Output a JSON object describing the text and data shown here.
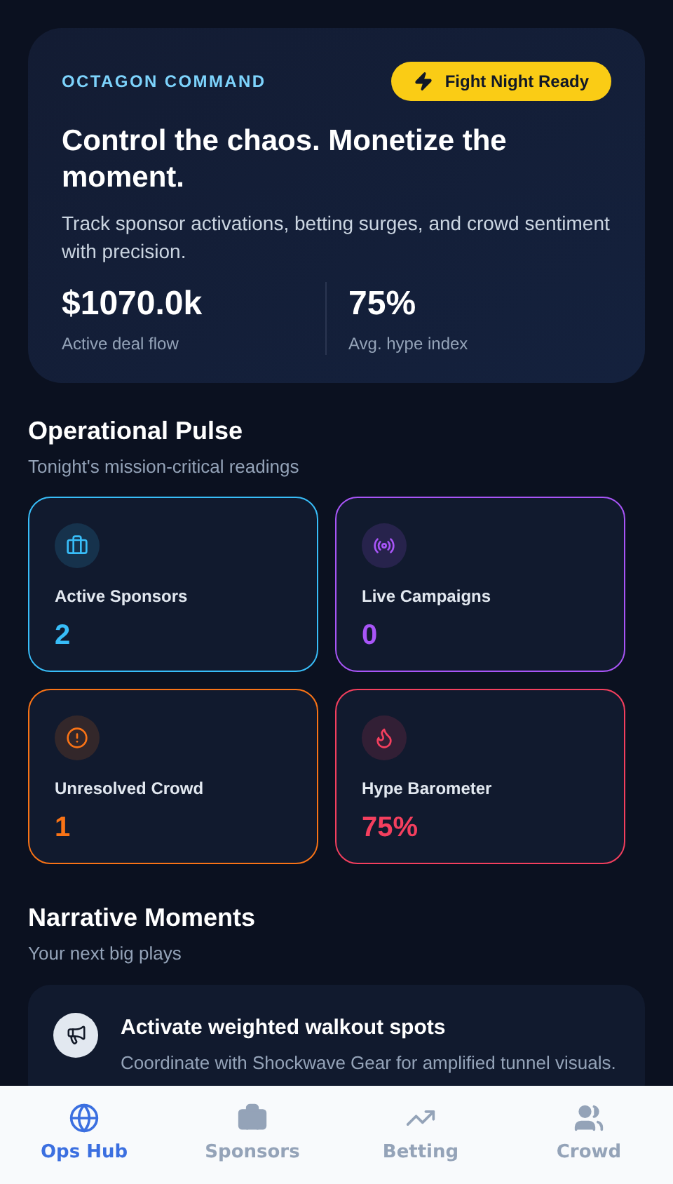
{
  "hero": {
    "eyebrow": "OCTAGON COMMAND",
    "badge": "Fight Night Ready",
    "title": "Control the chaos. Monetize the moment.",
    "subtitle": "Track sponsor activations, betting surges, and crowd sentiment with precision.",
    "stats": [
      {
        "value": "$1070.0k",
        "label": "Active deal flow"
      },
      {
        "value": "75%",
        "label": "Avg. hype index"
      }
    ]
  },
  "pulse": {
    "title": "Operational Pulse",
    "subtitle": "Tonight's mission-critical readings",
    "metrics": [
      {
        "kind": "sponsors",
        "label": "Active Sponsors",
        "value": "2",
        "color": "#38bdf8"
      },
      {
        "kind": "campaigns",
        "label": "Live Campaigns",
        "value": "0",
        "color": "#a855f7"
      },
      {
        "kind": "crowd",
        "label": "Unresolved Crowd",
        "value": "1",
        "color": "#f97316"
      },
      {
        "kind": "hype",
        "label": "Hype Barometer",
        "value": "75%",
        "color": "#f43f5e"
      }
    ]
  },
  "moments": {
    "title": "Narrative Moments",
    "subtitle": "Your next big plays",
    "items": [
      {
        "title": "Activate weighted walkout spots",
        "detail": "Coordinate with Shockwave Gear for amplified tunnel visuals."
      }
    ]
  },
  "nav": [
    {
      "kind": "hub",
      "label": "Ops Hub",
      "selected": true
    },
    {
      "kind": "sponsors",
      "label": "Sponsors",
      "selected": false
    },
    {
      "kind": "betting",
      "label": "Betting",
      "selected": false
    },
    {
      "kind": "crowd",
      "label": "Crowd",
      "selected": false
    }
  ]
}
